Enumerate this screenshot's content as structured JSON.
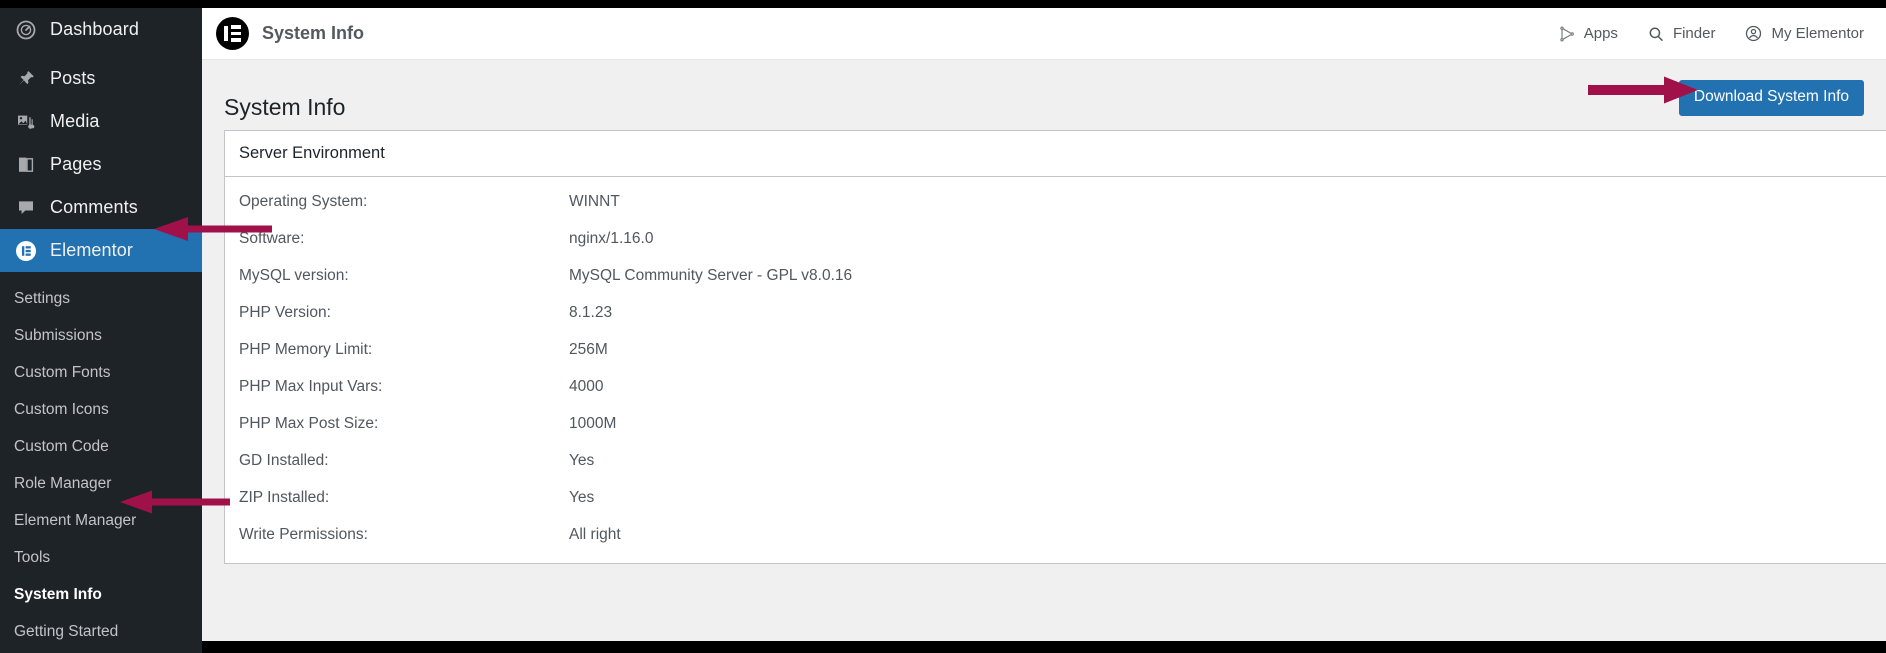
{
  "colors": {
    "sidebar_bg": "#1d2327",
    "sidebar_active": "#2271b1",
    "accent_button": "#2271b1",
    "arrow": "#a0114a",
    "content_bg": "#f0f0f1",
    "panel_border": "#c3c4c7"
  },
  "sidebar": {
    "main_items": [
      {
        "label": "Dashboard",
        "icon": "dashboard-icon",
        "active": false
      },
      {
        "label": "Posts",
        "icon": "pin-icon",
        "active": false
      },
      {
        "label": "Media",
        "icon": "media-icon",
        "active": false
      },
      {
        "label": "Pages",
        "icon": "pages-icon",
        "active": false
      },
      {
        "label": "Comments",
        "icon": "comments-icon",
        "active": false
      },
      {
        "label": "Elementor",
        "icon": "elementor-icon",
        "active": true
      }
    ],
    "sub_items": [
      {
        "label": "Settings",
        "current": false
      },
      {
        "label": "Submissions",
        "current": false
      },
      {
        "label": "Custom Fonts",
        "current": false
      },
      {
        "label": "Custom Icons",
        "current": false
      },
      {
        "label": "Custom Code",
        "current": false
      },
      {
        "label": "Role Manager",
        "current": false
      },
      {
        "label": "Element Manager",
        "current": false
      },
      {
        "label": "Tools",
        "current": false
      },
      {
        "label": "System Info",
        "current": true
      },
      {
        "label": "Getting Started",
        "current": false
      }
    ]
  },
  "appbar": {
    "logo": "elementor-logo-icon",
    "title": "System Info",
    "right_items": [
      {
        "label": "Apps",
        "icon": "apps-icon"
      },
      {
        "label": "Finder",
        "icon": "search-icon"
      },
      {
        "label": "My Elementor",
        "icon": "account-icon"
      }
    ]
  },
  "page": {
    "title": "System Info",
    "download_button": "Download System Info"
  },
  "panel": {
    "heading": "Server Environment",
    "rows": [
      {
        "label": "Operating System:",
        "value": "WINNT"
      },
      {
        "label": "Software:",
        "value": "nginx/1.16.0"
      },
      {
        "label": "MySQL version:",
        "value": "MySQL Community Server - GPL v8.0.16"
      },
      {
        "label": "PHP Version:",
        "value": "8.1.23"
      },
      {
        "label": "PHP Memory Limit:",
        "value": "256M"
      },
      {
        "label": "PHP Max Input Vars:",
        "value": "4000"
      },
      {
        "label": "PHP Max Post Size:",
        "value": "1000M"
      },
      {
        "label": "GD Installed:",
        "value": "Yes"
      },
      {
        "label": "ZIP Installed:",
        "value": "Yes"
      },
      {
        "label": "Write Permissions:",
        "value": "All right"
      }
    ]
  },
  "annotations": [
    {
      "name": "arrow-pointing-to-elementor",
      "direction": "left"
    },
    {
      "name": "arrow-pointing-to-system-info",
      "direction": "left"
    },
    {
      "name": "arrow-pointing-to-download-button",
      "direction": "right"
    }
  ]
}
